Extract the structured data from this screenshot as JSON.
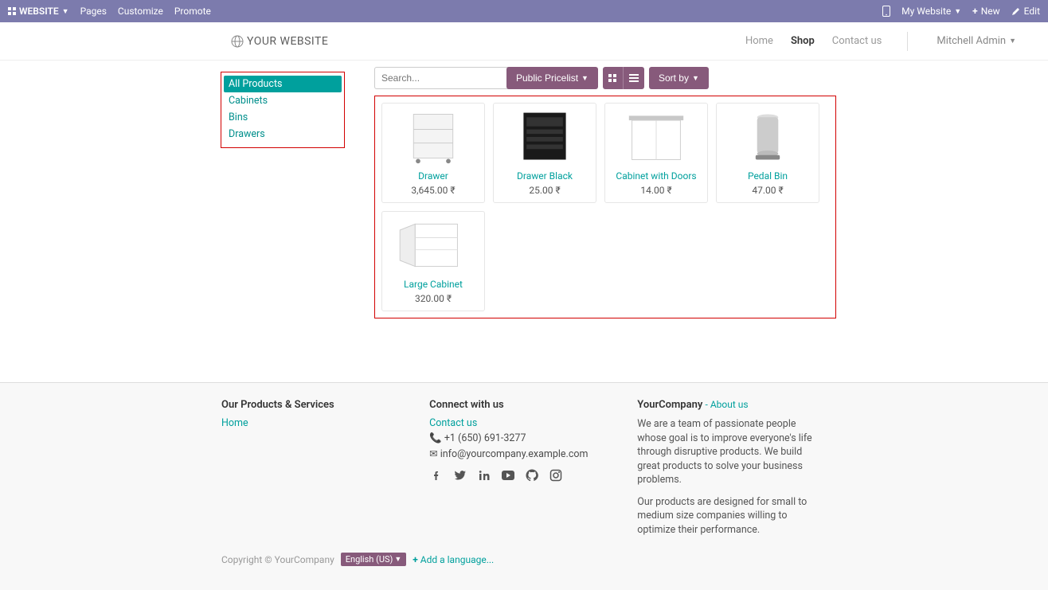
{
  "adminbar": {
    "website": "WEBSITE",
    "pages": "Pages",
    "customize": "Customize",
    "promote": "Promote",
    "my_website": "My Website",
    "new": "New",
    "edit": "Edit"
  },
  "brand": "YOUR WEBSITE",
  "nav": {
    "home": "Home",
    "shop": "Shop",
    "contact": "Contact us",
    "user": "Mitchell Admin"
  },
  "search": {
    "placeholder": "Search..."
  },
  "pricelist_label": "Public Pricelist",
  "sort_label": "Sort by",
  "categories": [
    {
      "label": "All Products",
      "active": true
    },
    {
      "label": "Cabinets",
      "active": false
    },
    {
      "label": "Bins",
      "active": false
    },
    {
      "label": "Drawers",
      "active": false
    }
  ],
  "products": [
    {
      "name": "Drawer",
      "price": "3,645.00 ₹"
    },
    {
      "name": "Drawer Black",
      "price": "25.00 ₹"
    },
    {
      "name": "Cabinet with Doors",
      "price": "14.00 ₹"
    },
    {
      "name": "Pedal Bin",
      "price": "47.00 ₹"
    },
    {
      "name": "Large Cabinet",
      "price": "320.00 ₹"
    }
  ],
  "footer": {
    "col1_title": "Our Products & Services",
    "col1_home": "Home",
    "col2_title": "Connect with us",
    "contact_us": "Contact us",
    "phone": "+1 (650) 691-3277",
    "email": "info@yourcompany.example.com",
    "col3_title": "YourCompany",
    "about_sep": " - ",
    "about": "About us",
    "desc1": "We are a team of passionate people whose goal is to improve everyone's life through disruptive products. We build great products to solve your business problems.",
    "desc2": "Our products are designed for small to medium size companies willing to optimize their performance."
  },
  "copyright": "Copyright © YourCompany",
  "lang": "English (US)",
  "add_lang": "Add a language..."
}
